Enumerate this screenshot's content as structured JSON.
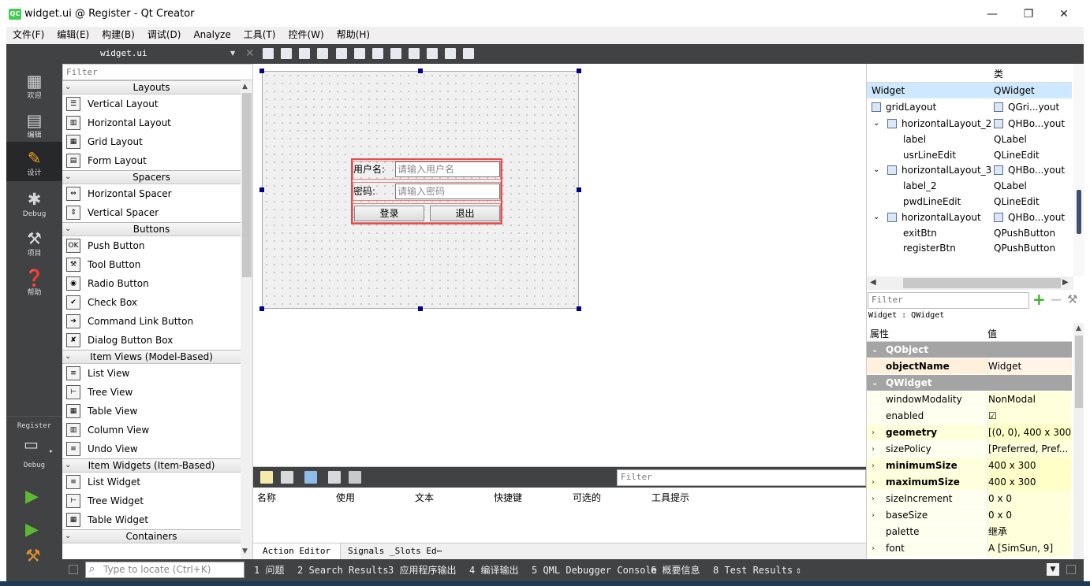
{
  "window": {
    "title": "widget.ui @ Register - Qt Creator",
    "logo": "QC",
    "minimize": "—",
    "restore": "❐",
    "close": "✕"
  },
  "menu": [
    "文件(F)",
    "编辑(E)",
    "构建(B)",
    "调试(D)",
    "Analyze",
    "工具(T)",
    "控件(W)",
    "帮助(H)"
  ],
  "modes": {
    "welcome": {
      "label": "欢迎",
      "icon": "grid-icon"
    },
    "edit": {
      "label": "编辑",
      "icon": "document-icon"
    },
    "design": {
      "label": "设计",
      "icon": "pencil-icon"
    },
    "debug": {
      "label": "Debug",
      "icon": "bug-icon"
    },
    "projects": {
      "label": "项目",
      "icon": "wrench-icon"
    },
    "help": {
      "label": "帮助",
      "icon": "question-icon"
    },
    "target_project": "Register",
    "target_build": "Debug"
  },
  "editor": {
    "file": "widget.ui"
  },
  "widget_box": {
    "filter": "Filter",
    "items": [
      {
        "kind": "cat",
        "text": "Layouts"
      },
      {
        "kind": "item",
        "text": "Vertical Layout",
        "icon": "☰"
      },
      {
        "kind": "item",
        "text": "Horizontal Layout",
        "icon": "▥"
      },
      {
        "kind": "item",
        "text": "Grid Layout",
        "icon": "▦"
      },
      {
        "kind": "item",
        "text": "Form Layout",
        "icon": "▤"
      },
      {
        "kind": "cat",
        "text": "Spacers"
      },
      {
        "kind": "item",
        "text": "Horizontal Spacer",
        "icon": "⇔"
      },
      {
        "kind": "item",
        "text": "Vertical Spacer",
        "icon": "⇕"
      },
      {
        "kind": "cat",
        "text": "Buttons"
      },
      {
        "kind": "item",
        "text": "Push Button",
        "icon": "OK"
      },
      {
        "kind": "item",
        "text": "Tool Button",
        "icon": "⚒"
      },
      {
        "kind": "item",
        "text": "Radio Button",
        "icon": "◉"
      },
      {
        "kind": "item",
        "text": "Check Box",
        "icon": "✔"
      },
      {
        "kind": "item",
        "text": "Command Link Button",
        "icon": "➔"
      },
      {
        "kind": "item",
        "text": "Dialog Button Box",
        "icon": "✘"
      },
      {
        "kind": "cat",
        "text": "Item Views (Model-Based)"
      },
      {
        "kind": "item",
        "text": "List View",
        "icon": "≡"
      },
      {
        "kind": "item",
        "text": "Tree View",
        "icon": "⊢"
      },
      {
        "kind": "item",
        "text": "Table View",
        "icon": "▦"
      },
      {
        "kind": "item",
        "text": "Column View",
        "icon": "▥"
      },
      {
        "kind": "item",
        "text": "Undo View",
        "icon": "≡"
      },
      {
        "kind": "cat",
        "text": "Item Widgets (Item-Based)"
      },
      {
        "kind": "item",
        "text": "List Widget",
        "icon": "≡"
      },
      {
        "kind": "item",
        "text": "Tree Widget",
        "icon": "⊢"
      },
      {
        "kind": "item",
        "text": "Table Widget",
        "icon": "▦"
      },
      {
        "kind": "cat",
        "text": "Containers"
      }
    ]
  },
  "form": {
    "username_label": "用户名:",
    "username_placeholder": "请输入用户名",
    "password_label": "密码:",
    "password_placeholder": "请输入密码",
    "login_button": "登录",
    "exit_button": "退出"
  },
  "action_editor": {
    "filter": "Filter",
    "columns": [
      "名称",
      "使用",
      "文本",
      "快捷键",
      "可选的",
      "工具提示"
    ],
    "tabs": [
      "Action Editor",
      "Signals _Slots Ed⋯"
    ]
  },
  "object_inspector": {
    "header_class": "类",
    "rows": [
      {
        "name": "Widget",
        "cls": "QWidget",
        "level": 0,
        "icon": false,
        "expand": false,
        "selected": true
      },
      {
        "name": "gridLayout",
        "cls": "QGri...yout",
        "level": 0,
        "icon": true,
        "expand": false
      },
      {
        "name": "horizontalLayout_2",
        "cls": "QHBo...yout",
        "level": 1,
        "icon": true,
        "expand": true
      },
      {
        "name": "label",
        "cls": "QLabel",
        "level": 2,
        "icon": false,
        "expand": false
      },
      {
        "name": "usrLineEdit",
        "cls": "QLineEdit",
        "level": 2,
        "icon": false,
        "expand": false
      },
      {
        "name": "horizontalLayout_3",
        "cls": "QHBo...yout",
        "level": 1,
        "icon": true,
        "expand": true
      },
      {
        "name": "label_2",
        "cls": "QLabel",
        "level": 2,
        "icon": false,
        "expand": false
      },
      {
        "name": "pwdLineEdit",
        "cls": "QLineEdit",
        "level": 2,
        "icon": false,
        "expand": false
      },
      {
        "name": "horizontalLayout",
        "cls": "QHBo...yout",
        "level": 1,
        "icon": true,
        "expand": true
      },
      {
        "name": "exitBtn",
        "cls": "QPushButton",
        "level": 2,
        "icon": false,
        "expand": false
      },
      {
        "name": "registerBtn",
        "cls": "QPushButton",
        "level": 2,
        "icon": false,
        "expand": false
      }
    ]
  },
  "property_editor": {
    "filter": "Filter",
    "title": "Widget : QWidget",
    "header_prop": "属性",
    "header_value": "值",
    "rows": [
      {
        "kind": "cat",
        "name": "QObject",
        "value": ""
      },
      {
        "kind": "prop",
        "name": "objectName",
        "value": "Widget",
        "bold": true,
        "style": "orange",
        "expand": false
      },
      {
        "kind": "cat",
        "name": "QWidget",
        "value": ""
      },
      {
        "kind": "prop",
        "name": "windowModality",
        "value": "NonModal",
        "bold": false,
        "style": "yellow",
        "expand": false
      },
      {
        "kind": "prop",
        "name": "enabled",
        "value": "☑",
        "bold": false,
        "style": "yellow",
        "expand": false
      },
      {
        "kind": "prop",
        "name": "geometry",
        "value": "[(0, 0), 400 x 300]",
        "bold": true,
        "style": "yellow2",
        "expand": true
      },
      {
        "kind": "prop",
        "name": "sizePolicy",
        "value": "[Preferred, Pref...",
        "bold": false,
        "style": "yellow",
        "expand": true
      },
      {
        "kind": "prop",
        "name": "minimumSize",
        "value": "400 x 300",
        "bold": true,
        "style": "yellow2",
        "expand": true
      },
      {
        "kind": "prop",
        "name": "maximumSize",
        "value": "400 x 300",
        "bold": true,
        "style": "yellow2",
        "expand": true
      },
      {
        "kind": "prop",
        "name": "sizeIncrement",
        "value": "0 x 0",
        "bold": false,
        "style": "yellow",
        "expand": true
      },
      {
        "kind": "prop",
        "name": "baseSize",
        "value": "0 x 0",
        "bold": false,
        "style": "yellow",
        "expand": true
      },
      {
        "kind": "prop",
        "name": "palette",
        "value": "继承",
        "bold": false,
        "style": "yellow",
        "expand": false
      },
      {
        "kind": "prop",
        "name": "font",
        "value": "A  [SimSun, 9]",
        "bold": false,
        "style": "yellow",
        "expand": true
      }
    ]
  },
  "statusbar": {
    "locator_placeholder": "Type to locate (Ctrl+K)",
    "panes": [
      "1 问题",
      "2 Search Results",
      "3 应用程序输出",
      "4 编译输出",
      "5 QML Debugger Console",
      "6 概要信息",
      "8 Test Results",
      "⇕"
    ]
  }
}
